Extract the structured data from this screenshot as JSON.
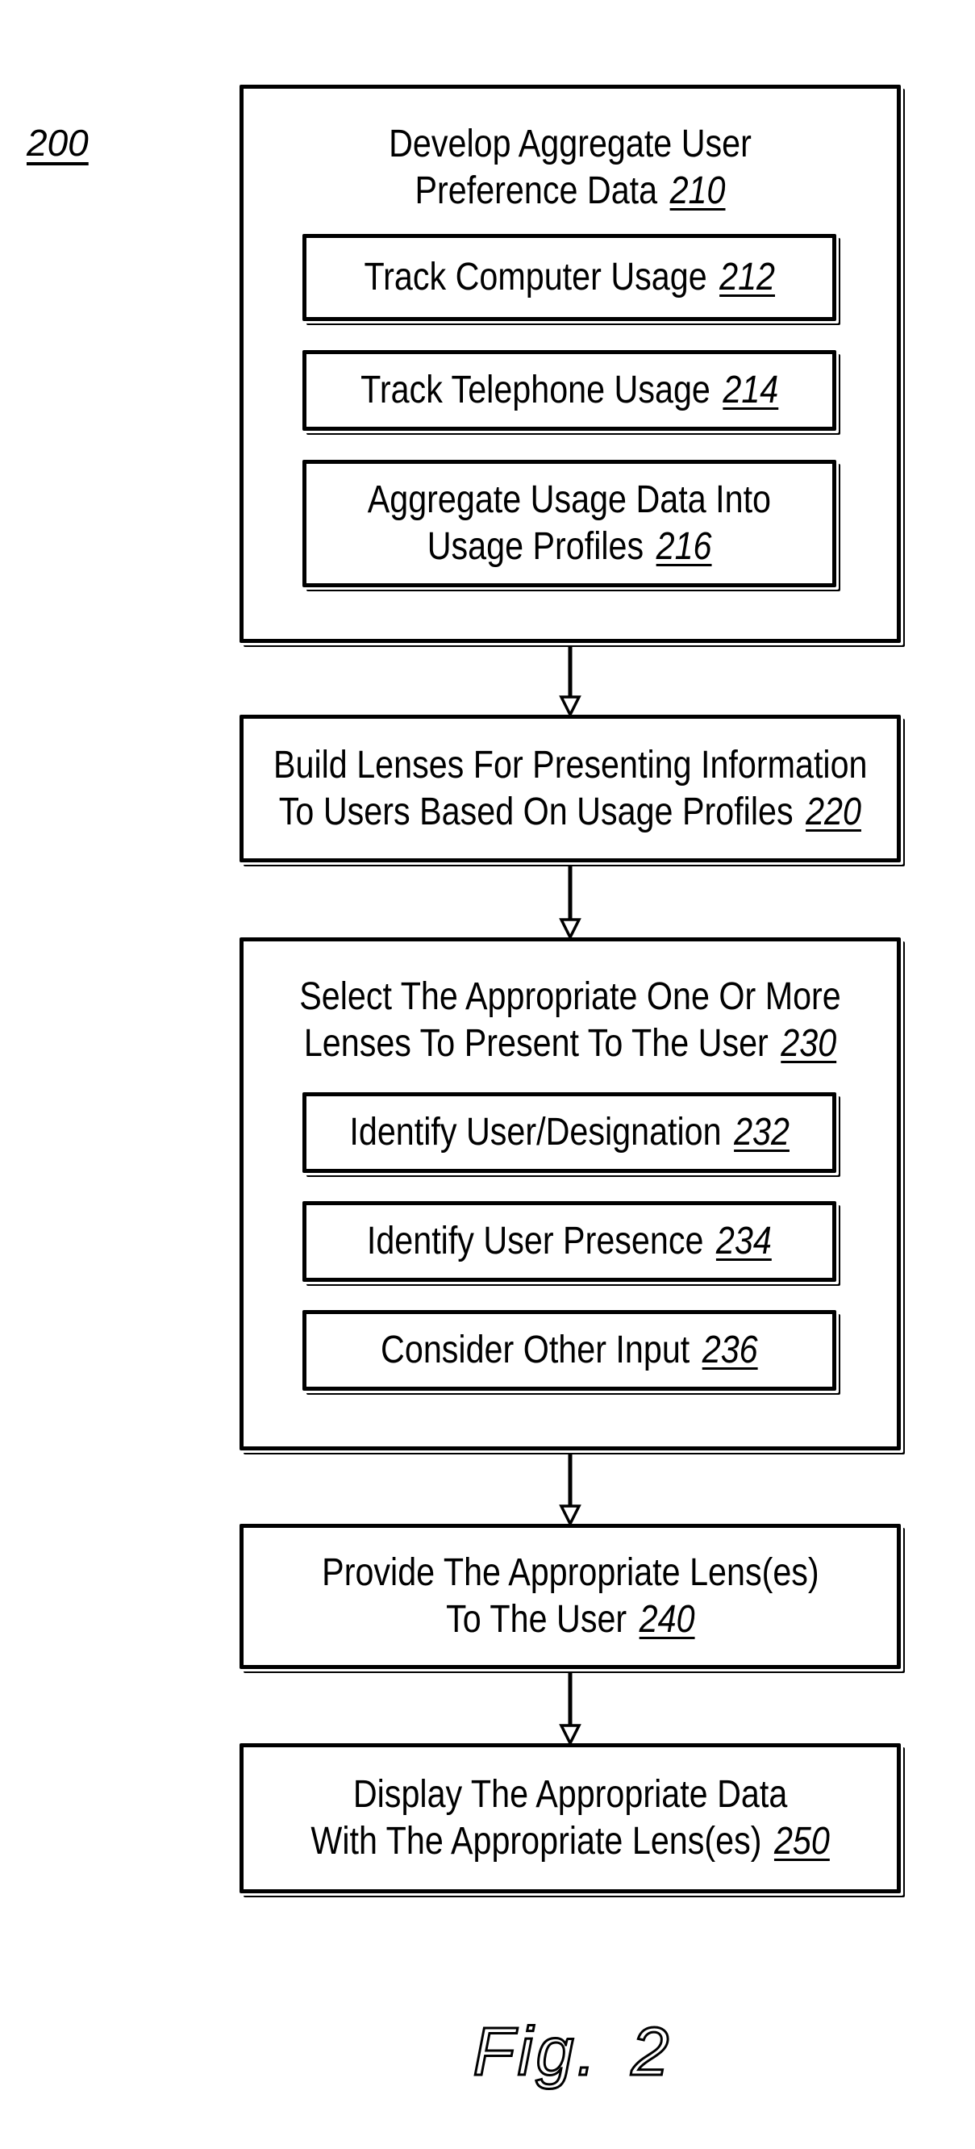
{
  "figure": {
    "reference_number": "200",
    "caption_prefix": "Fig.",
    "caption_number": "2"
  },
  "steps": {
    "s210": {
      "lines": [
        "Develop Aggregate User",
        "Preference Data"
      ],
      "number": "210"
    },
    "s212": {
      "lines": [
        "Track Computer Usage"
      ],
      "number": "212"
    },
    "s214": {
      "lines": [
        "Track Telephone Usage"
      ],
      "number": "214"
    },
    "s216": {
      "lines": [
        "Aggregate Usage Data Into",
        "Usage Profiles"
      ],
      "number": "216"
    },
    "s220": {
      "lines": [
        "Build Lenses For Presenting Information",
        "To Users Based On Usage Profiles"
      ],
      "number": "220"
    },
    "s230": {
      "lines": [
        "Select The Appropriate One Or More",
        "Lenses To Present To The User"
      ],
      "number": "230"
    },
    "s232": {
      "lines": [
        "Identify User/Designation"
      ],
      "number": "232"
    },
    "s234": {
      "lines": [
        "Identify User Presence"
      ],
      "number": "234"
    },
    "s236": {
      "lines": [
        "Consider Other Input"
      ],
      "number": "236"
    },
    "s240": {
      "lines": [
        "Provide The Appropriate Lens(es)",
        "To The User"
      ],
      "number": "240"
    },
    "s250": {
      "lines": [
        "Display The Appropriate Data",
        "With The Appropriate Lens(es)"
      ],
      "number": "250"
    }
  },
  "flow": [
    {
      "from": "210",
      "to": "220"
    },
    {
      "from": "220",
      "to": "230"
    },
    {
      "from": "230",
      "to": "240"
    },
    {
      "from": "240",
      "to": "250"
    }
  ]
}
